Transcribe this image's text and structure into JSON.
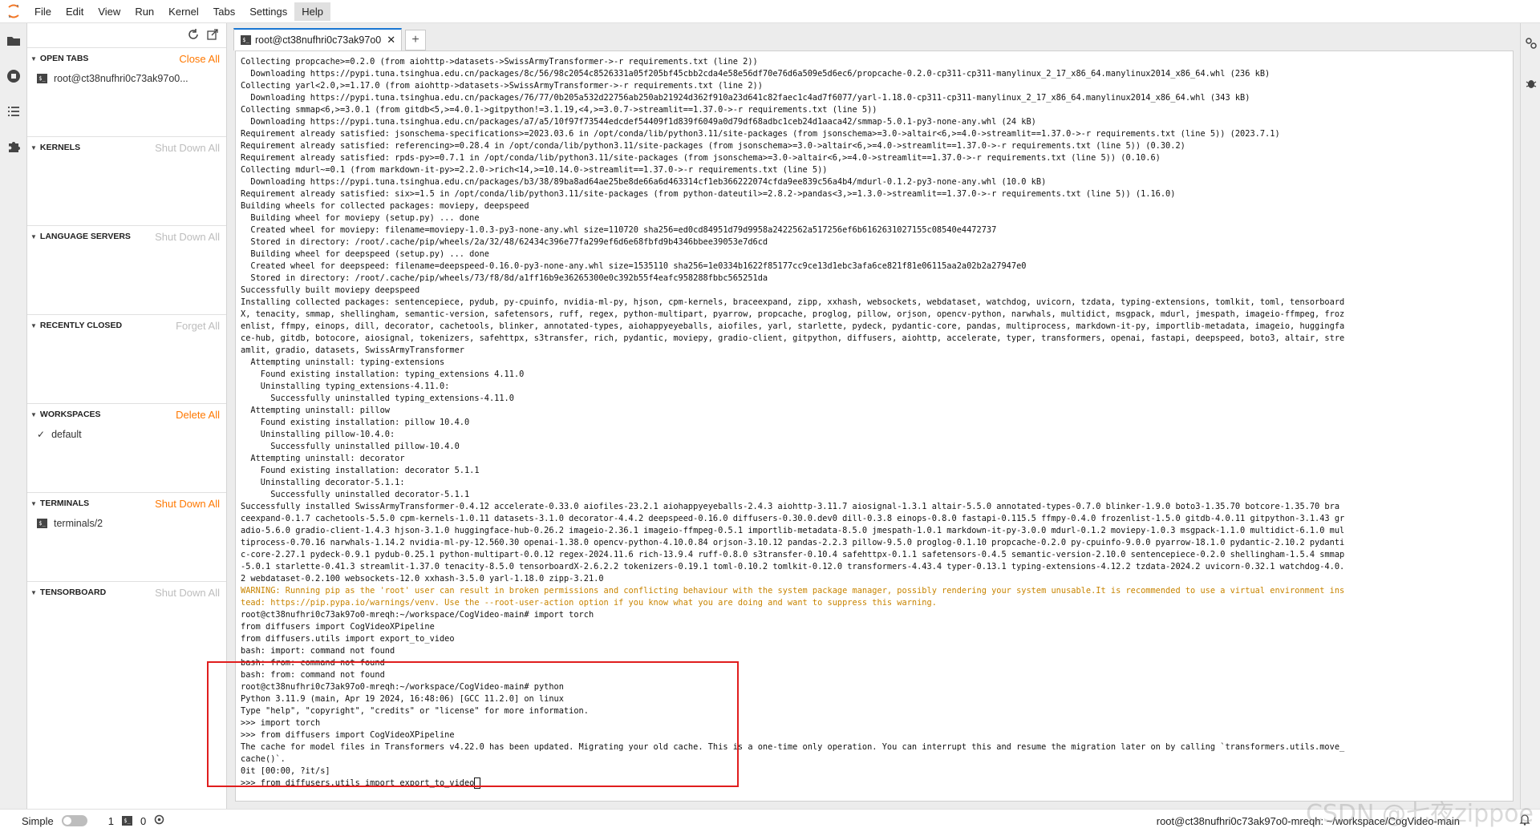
{
  "menubar": {
    "items": [
      "File",
      "Edit",
      "View",
      "Run",
      "Kernel",
      "Tabs",
      "Settings",
      "Help"
    ],
    "active": "Help"
  },
  "left_panel": {
    "sections": [
      {
        "title": "OPEN TABS",
        "action": "Close All",
        "action_enabled": true,
        "items": [
          "root@ct38nufhri0c73ak97o0..."
        ]
      },
      {
        "title": "KERNELS",
        "action": "Shut Down All",
        "action_enabled": false,
        "items": []
      },
      {
        "title": "LANGUAGE SERVERS",
        "action": "Shut Down All",
        "action_enabled": false,
        "items": []
      },
      {
        "title": "RECENTLY CLOSED",
        "action": "Forget All",
        "action_enabled": false,
        "items": []
      },
      {
        "title": "WORKSPACES",
        "action": "Delete All",
        "action_enabled": true,
        "items": [
          "default"
        ]
      },
      {
        "title": "TERMINALS",
        "action": "Shut Down All",
        "action_enabled": true,
        "items": [
          "terminals/2"
        ]
      },
      {
        "title": "TENSORBOARD",
        "action": "Shut Down All",
        "action_enabled": false,
        "items": []
      }
    ]
  },
  "tabs": {
    "active_label": "root@ct38nufhri0c73ak97o0",
    "add_label": "+"
  },
  "terminal": {
    "lines": [
      {
        "t": "Collecting propcache>=0.2.0 (from aiohttp->datasets->SwissArmyTransformer->-r requirements.txt (line 2))"
      },
      {
        "t": "  Downloading https://pypi.tuna.tsinghua.edu.cn/packages/8c/56/98c2054c8526331a05f205bf45cbb2cda4e58e56df70e76d6a509e5d6ec6/propcache-0.2.0-cp311-cp311-manylinux_2_17_x86_64.manylinux2014_x86_64.whl (236 kB)"
      },
      {
        "t": "Collecting yarl<2.0,>=1.17.0 (from aiohttp->datasets->SwissArmyTransformer->-r requirements.txt (line 2))"
      },
      {
        "t": "  Downloading https://pypi.tuna.tsinghua.edu.cn/packages/76/77/0b205a532d22756ab250ab21924d362f910a23d641c82faec1c4ad7f6077/yarl-1.18.0-cp311-cp311-manylinux_2_17_x86_64.manylinux2014_x86_64.whl (343 kB)"
      },
      {
        "t": "Collecting smmap<6,>=3.0.1 (from gitdb<5,>=4.0.1->gitpython!=3.1.19,<4,>=3.0.7->streamlit==1.37.0->-r requirements.txt (line 5))"
      },
      {
        "t": "  Downloading https://pypi.tuna.tsinghua.edu.cn/packages/a7/a5/10f97f73544edcdef54409f1d839f6049a0d79df68adbc1ceb24d1aaca42/smmap-5.0.1-py3-none-any.whl (24 kB)"
      },
      {
        "t": "Requirement already satisfied: jsonschema-specifications>=2023.03.6 in /opt/conda/lib/python3.11/site-packages (from jsonschema>=3.0->altair<6,>=4.0->streamlit==1.37.0->-r requirements.txt (line 5)) (2023.7.1)"
      },
      {
        "t": "Requirement already satisfied: referencing>=0.28.4 in /opt/conda/lib/python3.11/site-packages (from jsonschema>=3.0->altair<6,>=4.0->streamlit==1.37.0->-r requirements.txt (line 5)) (0.30.2)"
      },
      {
        "t": "Requirement already satisfied: rpds-py>=0.7.1 in /opt/conda/lib/python3.11/site-packages (from jsonschema>=3.0->altair<6,>=4.0->streamlit==1.37.0->-r requirements.txt (line 5)) (0.10.6)"
      },
      {
        "t": "Collecting mdurl~=0.1 (from markdown-it-py>=2.2.0->rich<14,>=10.14.0->streamlit==1.37.0->-r requirements.txt (line 5))"
      },
      {
        "t": "  Downloading https://pypi.tuna.tsinghua.edu.cn/packages/b3/38/89ba8ad64ae25be8de66a6d463314cf1eb366222074cfda9ee839c56a4b4/mdurl-0.1.2-py3-none-any.whl (10.0 kB)"
      },
      {
        "t": "Requirement already satisfied: six>=1.5 in /opt/conda/lib/python3.11/site-packages (from python-dateutil>=2.8.2->pandas<3,>=1.3.0->streamlit==1.37.0->-r requirements.txt (line 5)) (1.16.0)"
      },
      {
        "t": "Building wheels for collected packages: moviepy, deepspeed"
      },
      {
        "t": "  Building wheel for moviepy (setup.py) ... done"
      },
      {
        "t": "  Created wheel for moviepy: filename=moviepy-1.0.3-py3-none-any.whl size=110720 sha256=ed0cd84951d79d9958a2422562a517256ef6b6162631027155c08540e4472737"
      },
      {
        "t": "  Stored in directory: /root/.cache/pip/wheels/2a/32/48/62434c396e77fa299ef6d6e68fbfd9b4346bbee39053e7d6cd"
      },
      {
        "t": "  Building wheel for deepspeed (setup.py) ... done"
      },
      {
        "t": "  Created wheel for deepspeed: filename=deepspeed-0.16.0-py3-none-any.whl size=1535110 sha256=1e0334b1622f85177cc9ce13d1ebc3afa6ce821f81e06115aa2a02b2a27947e0"
      },
      {
        "t": "  Stored in directory: /root/.cache/pip/wheels/73/f8/8d/a1ff16b9e36265300e0c392b55f4eafc958288fbbc565251da"
      },
      {
        "t": "Successfully built moviepy deepspeed"
      },
      {
        "t": "Installing collected packages: sentencepiece, pydub, py-cpuinfo, nvidia-ml-py, hjson, cpm-kernels, braceexpand, zipp, xxhash, websockets, webdataset, watchdog, uvicorn, tzdata, typing-extensions, tomlkit, toml, tensorboard"
      },
      {
        "t": "X, tenacity, smmap, shellingham, semantic-version, safetensors, ruff, regex, python-multipart, pyarrow, propcache, proglog, pillow, orjson, opencv-python, narwhals, multidict, msgpack, mdurl, jmespath, imageio-ffmpeg, froz"
      },
      {
        "t": "enlist, ffmpy, einops, dill, decorator, cachetools, blinker, annotated-types, aiohappyeyeballs, aiofiles, yarl, starlette, pydeck, pydantic-core, pandas, multiprocess, markdown-it-py, importlib-metadata, imageio, huggingfa"
      },
      {
        "t": "ce-hub, gitdb, botocore, aiosignal, tokenizers, safehttpx, s3transfer, rich, pydantic, moviepy, gradio-client, gitpython, diffusers, aiohttp, accelerate, typer, transformers, openai, fastapi, deepspeed, boto3, altair, stre"
      },
      {
        "t": "amlit, gradio, datasets, SwissArmyTransformer"
      },
      {
        "t": "  Attempting uninstall: typing-extensions"
      },
      {
        "t": "    Found existing installation: typing_extensions 4.11.0"
      },
      {
        "t": "    Uninstalling typing_extensions-4.11.0:"
      },
      {
        "t": "      Successfully uninstalled typing_extensions-4.11.0"
      },
      {
        "t": "  Attempting uninstall: pillow"
      },
      {
        "t": "    Found existing installation: pillow 10.4.0"
      },
      {
        "t": "    Uninstalling pillow-10.4.0:"
      },
      {
        "t": "      Successfully uninstalled pillow-10.4.0"
      },
      {
        "t": "  Attempting uninstall: decorator"
      },
      {
        "t": "    Found existing installation: decorator 5.1.1"
      },
      {
        "t": "    Uninstalling decorator-5.1.1:"
      },
      {
        "t": "      Successfully uninstalled decorator-5.1.1"
      },
      {
        "t": "Successfully installed SwissArmyTransformer-0.4.12 accelerate-0.33.0 aiofiles-23.2.1 aiohappyeyeballs-2.4.3 aiohttp-3.11.7 aiosignal-1.3.1 altair-5.5.0 annotated-types-0.7.0 blinker-1.9.0 boto3-1.35.70 botcore-1.35.70 bra"
      },
      {
        "t": "ceexpand-0.1.7 cachetools-5.5.0 cpm-kernels-1.0.11 datasets-3.1.0 decorator-4.4.2 deepspeed-0.16.0 diffusers-0.30.0.dev0 dill-0.3.8 einops-0.8.0 fastapi-0.115.5 ffmpy-0.4.0 frozenlist-1.5.0 gitdb-4.0.11 gitpython-3.1.43 gr"
      },
      {
        "t": "adio-5.6.0 gradio-client-1.4.3 hjson-3.1.0 huggingface-hub-0.26.2 imageio-2.36.1 imageio-ffmpeg-0.5.1 importlib-metadata-8.5.0 jmespath-1.0.1 markdown-it-py-3.0.0 mdurl-0.1.2 moviepy-1.0.3 msgpack-1.1.0 multidict-6.1.0 mul"
      },
      {
        "t": "tiprocess-0.70.16 narwhals-1.14.2 nvidia-ml-py-12.560.30 openai-1.38.0 opencv-python-4.10.0.84 orjson-3.10.12 pandas-2.2.3 pillow-9.5.0 proglog-0.1.10 propcache-0.2.0 py-cpuinfo-9.0.0 pyarrow-18.1.0 pydantic-2.10.2 pydanti"
      },
      {
        "t": "c-core-2.27.1 pydeck-0.9.1 pydub-0.25.1 python-multipart-0.0.12 regex-2024.11.6 rich-13.9.4 ruff-0.8.0 s3transfer-0.10.4 safehttpx-0.1.1 safetensors-0.4.5 semantic-version-2.10.0 sentencepiece-0.2.0 shellingham-1.5.4 smmap"
      },
      {
        "t": "-5.0.1 starlette-0.41.3 streamlit-1.37.0 tenacity-8.5.0 tensorboardX-2.6.2.2 tokenizers-0.19.1 toml-0.10.2 tomlkit-0.12.0 transformers-4.43.4 typer-0.13.1 typing-extensions-4.12.2 tzdata-2024.2 uvicorn-0.32.1 watchdog-4.0."
      },
      {
        "t": "2 webdataset-0.2.100 websockets-12.0 xxhash-3.5.0 yarl-1.18.0 zipp-3.21.0"
      },
      {
        "t": "WARNING: Running pip as the 'root' user can result in broken permissions and conflicting behaviour with the system package manager, possibly rendering your system unusable.It is recommended to use a virtual environment ins",
        "warn": true
      },
      {
        "t": "tead: https://pip.pypa.io/warnings/venv. Use the --root-user-action option if you know what you are doing and want to suppress this warning.",
        "warn": true
      },
      {
        "t": "root@ct38nufhri0c73ak97o0-mreqh:~/workspace/CogVideo-main# import torch"
      },
      {
        "t": "from diffusers import CogVideoXPipeline"
      },
      {
        "t": "from diffusers.utils import export_to_video"
      },
      {
        "t": "bash: import: command not found"
      },
      {
        "t": "bash: from: command not found"
      },
      {
        "t": "bash: from: command not found"
      },
      {
        "t": "root@ct38nufhri0c73ak97o0-mreqh:~/workspace/CogVideo-main# python"
      },
      {
        "t": "Python 3.11.9 (main, Apr 19 2024, 16:48:06) [GCC 11.2.0] on linux"
      },
      {
        "t": "Type \"help\", \"copyright\", \"credits\" or \"license\" for more information."
      },
      {
        "t": ">>> import torch"
      },
      {
        "t": ">>> from diffusers import CogVideoXPipeline"
      },
      {
        "t": "The cache for model files in Transformers v4.22.0 has been updated. Migrating your old cache. This is a one-time only operation. You can interrupt this and resume the migration later on by calling `transformers.utils.move_"
      },
      {
        "t": "cache()`."
      },
      {
        "t": "0it [00:00, ?it/s]"
      },
      {
        "t": ">>> from diffusers.utils import export_to_video",
        "cursor": true
      }
    ]
  },
  "statusbar": {
    "mode_label": "Simple",
    "terminals_count": "1",
    "kernels_count": "0",
    "path": "root@ct38nufhri0c73ak97o0-mreqh: ~/workspace/CogVideo-main",
    "watermark": "CSDN @七夜zippoe"
  },
  "colors": {
    "accent": "#ff7800",
    "tab_accent": "#1976d2",
    "highlight_box": "#e01e1e",
    "warning_text": "#c88400"
  }
}
